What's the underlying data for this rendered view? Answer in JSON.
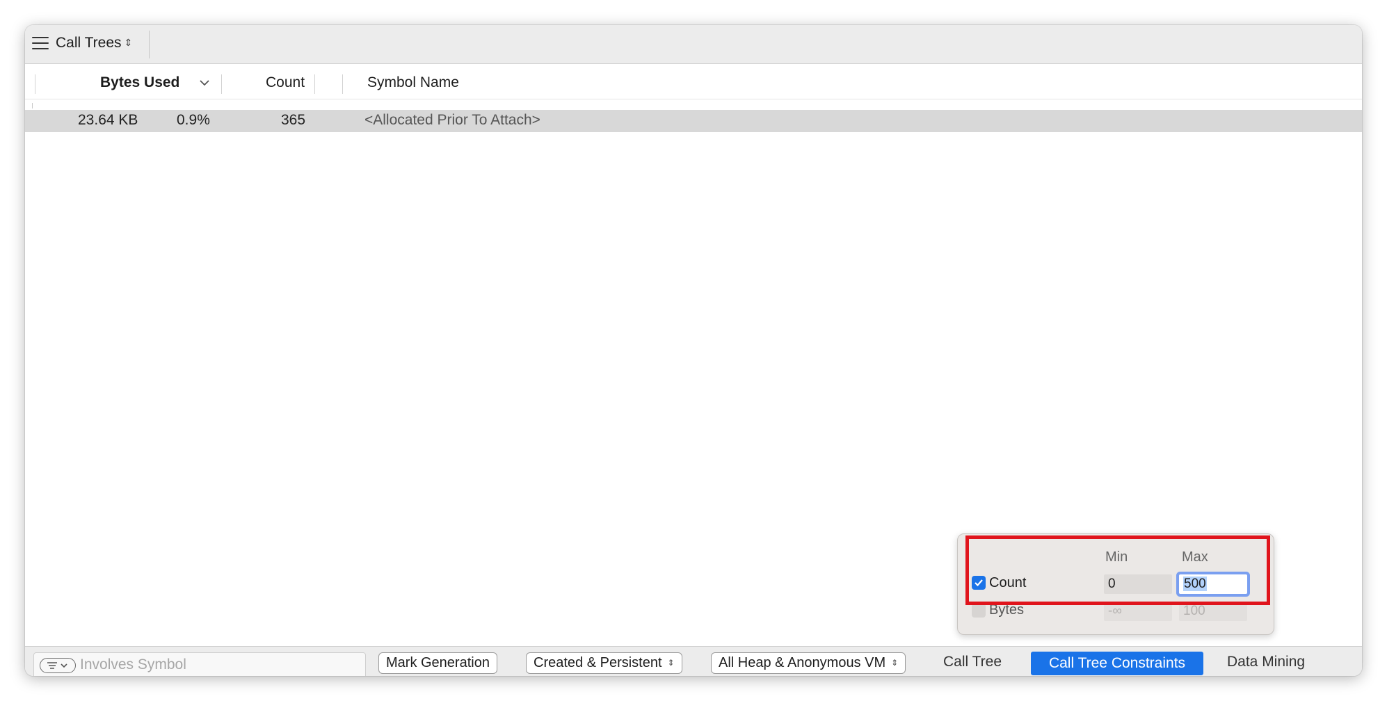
{
  "toolbar": {
    "view_picker": "Call Trees",
    "updown": "⇕"
  },
  "columns": {
    "bytes_used": "Bytes Used",
    "count": "Count",
    "symbol_name": "Symbol Name"
  },
  "rows": [
    {
      "bytes": "23.64 KB",
      "percent": "0.9%",
      "count": "365",
      "symbol": "<Allocated Prior To Attach>"
    }
  ],
  "bottom_bar": {
    "filter_placeholder": "Involves Symbol",
    "mark_generation": "Mark Generation",
    "created_persistent": "Created & Persistent",
    "heap_filter": "All Heap & Anonymous VM",
    "tabs": [
      "Call Tree",
      "Call Tree Constraints",
      "Data Mining"
    ],
    "active_tab": "Call Tree Constraints"
  },
  "constraints_popover": {
    "min_label": "Min",
    "max_label": "Max",
    "rows": [
      {
        "label": "Count",
        "checked": true,
        "min": "0",
        "max": "500"
      },
      {
        "label": "Bytes",
        "checked": false,
        "min": "-∞",
        "max": "100"
      }
    ]
  },
  "colors": {
    "accent": "#1a73e8",
    "highlight": "#e0141c",
    "row_selected": "#d8d8d8"
  }
}
